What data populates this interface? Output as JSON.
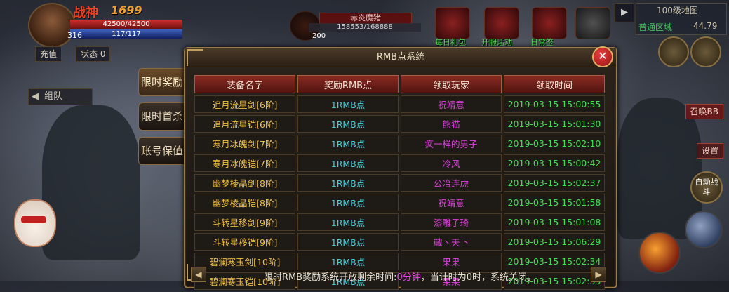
{
  "hud": {
    "player_name": "战神",
    "power": "1699",
    "hp": "42500/42500",
    "mp": "117/117",
    "level": "316",
    "recharge": "充值",
    "status": "状态",
    "status_count": "0",
    "team": "组队"
  },
  "boss": {
    "name": "赤炎魔猪",
    "hp": "158553/168888",
    "count": "200"
  },
  "top_icons": [
    {
      "label": "每日礼包"
    },
    {
      "label": "开服活动"
    },
    {
      "label": "日常签"
    }
  ],
  "map": {
    "name": "100级地图",
    "area": "普通区域",
    "coords": "44.79"
  },
  "right_buttons": {
    "summon": "召唤BB",
    "settings": "设置",
    "auto_fight": "自动战斗"
  },
  "side_tabs": [
    "限时奖励",
    "限时首杀",
    "账号保值"
  ],
  "panel": {
    "title": "RMB点系统",
    "close": "✕",
    "columns": [
      "装备名字",
      "奖励RMB点",
      "领取玩家",
      "领取时间"
    ],
    "rows": [
      [
        "追月流星剑[6阶]",
        "1RMB点",
        "祝靖意",
        "2019-03-15  15:00:55"
      ],
      [
        "追月流星铠[6阶]",
        "1RMB点",
        "熊猫",
        "2019-03-15  15:01:30"
      ],
      [
        "寒月冰魄剑[7阶]",
        "1RMB点",
        "疯一样的男子",
        "2019-03-15  15:02:10"
      ],
      [
        "寒月冰魄铠[7阶]",
        "1RMB点",
        "冷风",
        "2019-03-15  15:00:42"
      ],
      [
        "幽梦棱晶剑[8阶]",
        "1RMB点",
        "公冶连虎",
        "2019-03-15  15:02:37"
      ],
      [
        "幽梦棱晶铠[8阶]",
        "1RMB点",
        "祝靖意",
        "2019-03-15  15:01:58"
      ],
      [
        "斗转星移剑[9阶]",
        "1RMB点",
        "漆雕子琦",
        "2019-03-15  15:01:08"
      ],
      [
        "斗转星移铠[9阶]",
        "1RMB点",
        "戰丶天下",
        "2019-03-15  15:06:29"
      ],
      [
        "碧澜寒玉剑[10阶]",
        "1RMB点",
        "果果",
        "2019-03-15  15:02:34"
      ],
      [
        "碧澜寒玉铠[10阶]",
        "1RMB点",
        "果果",
        "2019-03-15  15:02:35"
      ]
    ],
    "footer_prefix": "限时RMB奖励系统开放剩余时间:",
    "footer_highlight": "0分钟",
    "footer_suffix": "，当计时为0时，系统关闭。"
  }
}
